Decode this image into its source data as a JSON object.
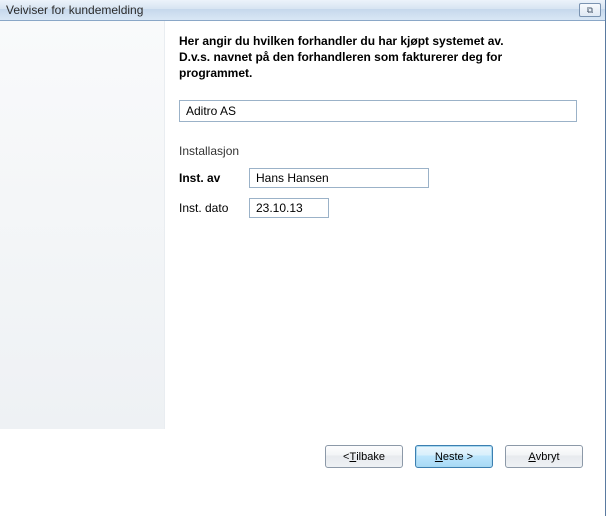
{
  "window": {
    "title": "Veiviser for kundemelding",
    "close_glyph": "⧉"
  },
  "main": {
    "intro": "Her angir du hvilken forhandler du har kjøpt systemet av. D.v.s. navnet på den forhandleren som fakturerer deg for programmet.",
    "dealer_value": "Aditro AS",
    "section_label": "Installasjon",
    "inst_by_label": "Inst. av",
    "inst_by_value": "Hans Hansen",
    "inst_date_label": "Inst. dato",
    "inst_date_value": "23.10.13"
  },
  "buttons": {
    "back_prefix": "< ",
    "back_u": "T",
    "back_rest": "ilbake",
    "next_u": "N",
    "next_rest": "este >",
    "cancel_u": "A",
    "cancel_rest": "vbryt"
  }
}
